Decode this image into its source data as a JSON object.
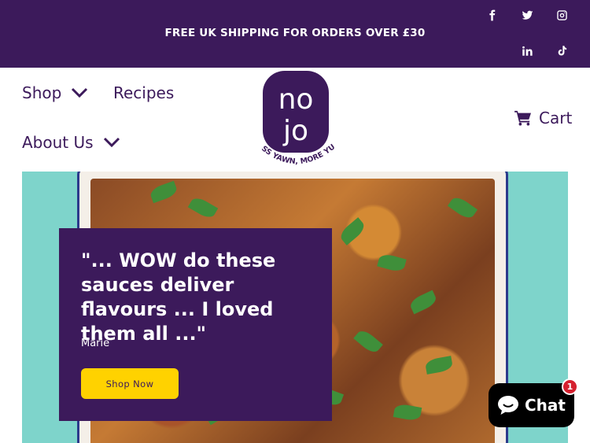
{
  "announcement": "FREE UK SHIPPING FOR ORDERS OVER £30",
  "social": [
    "facebook-icon",
    "twitter-icon",
    "instagram-icon",
    "linkedin-icon",
    "tiktok-icon"
  ],
  "nav": {
    "shop": "Shop",
    "recipes": "Recipes",
    "about": "About Us",
    "cart": "Cart"
  },
  "logo": {
    "top": "no",
    "bottom": "jo",
    "tagline": "LESS YAWN, MORE YUM"
  },
  "hero": {
    "quote": "\"... WOW do these sauces deliver flavours ... I loved them all ...\"",
    "author": "Marie",
    "button": "Shop Now"
  },
  "chat": {
    "label": "Chat",
    "badge": "1"
  },
  "colors": {
    "brand_purple": "#3c1a5b",
    "button_yellow": "#ffd200",
    "hero_teal": "#7ed4cb",
    "badge_red": "#d5202f"
  }
}
